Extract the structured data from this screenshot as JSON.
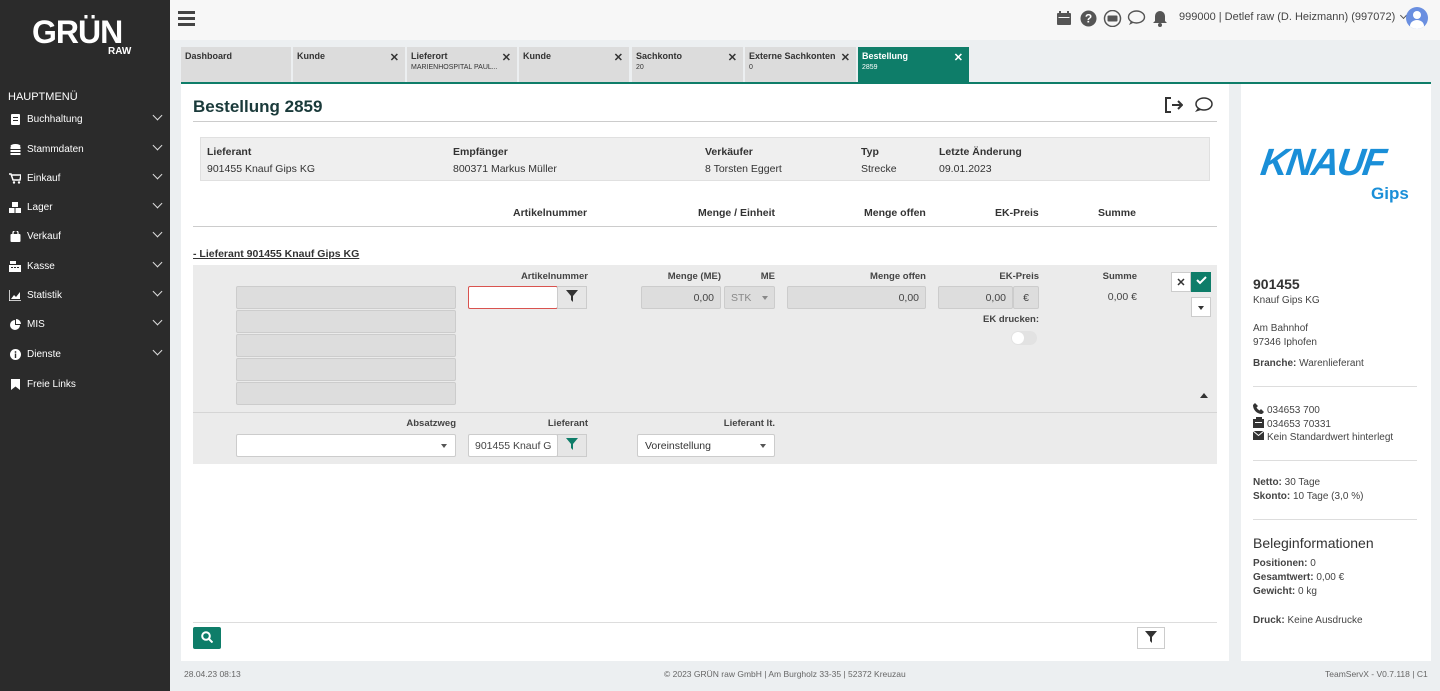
{
  "brand": {
    "name": "GRÜN",
    "sub": "RAW"
  },
  "sidebar": {
    "title": "HAUPTMENÜ",
    "items": [
      {
        "label": "Buchhaltung",
        "icon": "ledger-icon"
      },
      {
        "label": "Stammdaten",
        "icon": "database-icon"
      },
      {
        "label": "Einkauf",
        "icon": "cart-icon"
      },
      {
        "label": "Lager",
        "icon": "boxes-icon"
      },
      {
        "label": "Verkauf",
        "icon": "shopping-bag-icon"
      },
      {
        "label": "Kasse",
        "icon": "cash-register-icon"
      },
      {
        "label": "Statistik",
        "icon": "area-chart-icon"
      },
      {
        "label": "MIS",
        "icon": "pie-chart-icon"
      },
      {
        "label": "Dienste",
        "icon": "info-icon"
      },
      {
        "label": "Freie Links",
        "icon": "bookmark-icon"
      }
    ]
  },
  "topbar": {
    "user": "999000 | Detlef raw (D. Heizmann) (997072)"
  },
  "tabs": [
    {
      "label": "Dashboard",
      "sub": ""
    },
    {
      "label": "Kunde",
      "sub": ""
    },
    {
      "label": "Lieferort",
      "sub": "MARIENHOSPITAL PAUL..."
    },
    {
      "label": "Kunde",
      "sub": ""
    },
    {
      "label": "Sachkonto",
      "sub": "20"
    },
    {
      "label": "Externe Sachkonten",
      "sub": "0"
    },
    {
      "label": "Bestellung",
      "sub": "2859"
    }
  ],
  "page": {
    "title": "Bestellung 2859"
  },
  "header": {
    "lieferant": {
      "label": "Lieferant",
      "value": "901455 Knauf Gips KG"
    },
    "empfaenger": {
      "label": "Empfänger",
      "value": "800371 Markus Müller"
    },
    "verkaeufer": {
      "label": "Verkäufer",
      "value": "8 Torsten Eggert"
    },
    "typ": {
      "label": "Typ",
      "value": "Strecke"
    },
    "aenderung": {
      "label": "Letzte Änderung",
      "value": "09.01.2023"
    }
  },
  "columns": {
    "artikelnummer": "Artikelnummer",
    "menge": "Menge / Einheit",
    "offen": "Menge offen",
    "ekpreis": "EK-Preis",
    "summe": "Summe"
  },
  "group": {
    "title": "- Lieferant 901455 Knauf Gips KG"
  },
  "edit": {
    "artikel_label": "Artikelnummer",
    "menge_label": "Menge (ME)",
    "menge_value": "0,00",
    "me_label": "ME",
    "me_value": "STK",
    "offen_label": "Menge offen",
    "offen_value": "0,00",
    "ek_label": "EK-Preis",
    "ek_value": "0,00",
    "currency": "€",
    "summe_label": "Summe",
    "summe_value": "0,00 €",
    "drucken_label": "EK drucken:",
    "absatzweg_label": "Absatzweg",
    "absatzweg_value": "",
    "lieferant_label": "Lieferant",
    "lieferant_value": "901455 Knauf G",
    "lieferant_lt_label": "Lieferant lt.",
    "lieferant_lt_value": "Voreinstellung"
  },
  "supplier": {
    "logo_main": "KNAUF",
    "logo_sub": "Gips",
    "id": "901455",
    "name": "Knauf Gips KG",
    "street": "Am Bahnhof",
    "city": "97346 Iphofen",
    "branche_label": "Branche:",
    "branche": "Warenlieferant",
    "phone": "034653 700",
    "fax": "034653 70331",
    "email": "Kein Standardwert hinterlegt",
    "netto_label": "Netto:",
    "netto": "30 Tage",
    "skonto_label": "Skonto:",
    "skonto": "10 Tage (3,0 %)"
  },
  "beleg": {
    "title": "Beleginformationen",
    "positionen_label": "Positionen:",
    "positionen": "0",
    "gesamtwert_label": "Gesamtwert:",
    "gesamtwert": "0,00 €",
    "gewicht_label": "Gewicht:",
    "gewicht": "0 kg",
    "druck_label": "Druck:",
    "druck": "Keine Ausdrucke"
  },
  "footer": {
    "left": "28.04.23 08:13",
    "center": "© 2023 GRÜN raw GmbH | Am Burgholz 33-35 | 52372 Kreuzau",
    "right": "TeamServX - V0.7.118 | C1"
  },
  "colors": {
    "accent": "#0e7d69",
    "sidebar": "#2b2b2b",
    "logo": "#1a8fd8"
  }
}
